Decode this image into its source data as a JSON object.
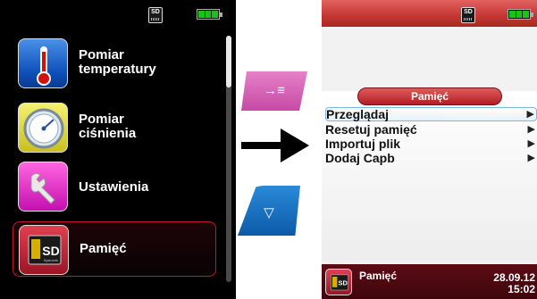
{
  "left_screen": {
    "status_bar": {
      "sd_label": "SD",
      "battery_cells": 3
    },
    "menu": [
      {
        "line1": "Pomiar",
        "line2": "temperatury",
        "icon": "thermometer-icon"
      },
      {
        "line1": "Pomiar",
        "line2": "ciśnienia",
        "icon": "pressure-gauge-icon"
      },
      {
        "line1": "Ustawienia",
        "line2": "",
        "icon": "wrench-icon"
      },
      {
        "line1": "Pamięć",
        "line2": "",
        "icon": "sd-card-icon",
        "selected": true
      }
    ],
    "scroll_position": 0.0
  },
  "controls": {
    "enter_key_glyph": "→≡",
    "down_key_glyph": "▽"
  },
  "right_screen": {
    "status_bar": {
      "sd_label": "SD",
      "battery_cells": 3
    },
    "panel_title": "Pamięć",
    "options": [
      {
        "label": "Przeglądaj",
        "arrow": "▶",
        "selected": true
      },
      {
        "label": "Resetuj pamięć",
        "arrow": "▶"
      },
      {
        "label": "Importuj plik",
        "arrow": "▶"
      },
      {
        "label": "Dodaj Capb",
        "arrow": "▶"
      }
    ],
    "bottom_bar": {
      "title": "Pamięć",
      "date": "28.09.12",
      "time": "15:02"
    }
  },
  "colors": {
    "selection_border": "#c0182a",
    "header_red": "#b01f25",
    "option_highlight": "#7bb7e0",
    "battery_green": "#16c416"
  },
  "icon_texts": {
    "sd_big": "SD",
    "sd_brand": "Systronik"
  }
}
